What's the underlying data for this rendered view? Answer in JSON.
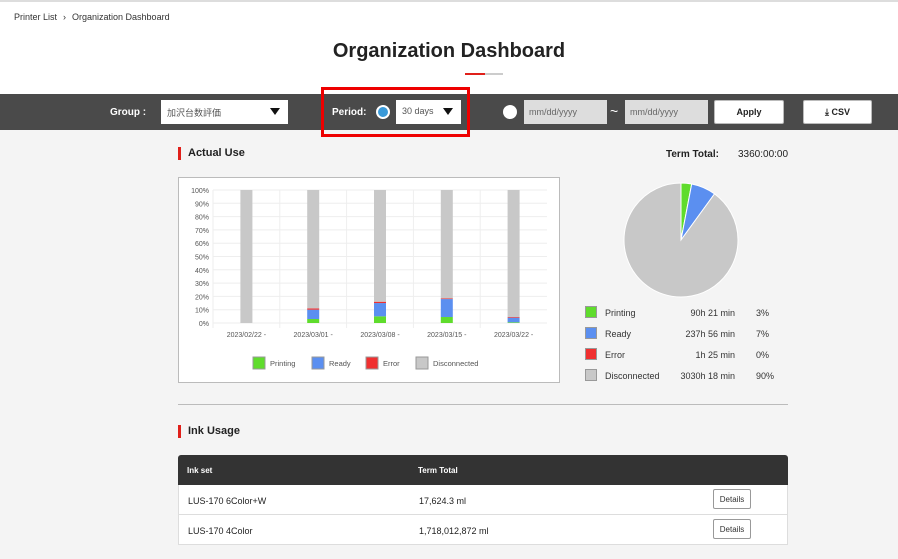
{
  "breadcrumb": [
    "Printer List",
    "Organization Dashboard"
  ],
  "title": "Organization Dashboard",
  "filter": {
    "group_label": "Group :",
    "group_value": "加沢台数評価",
    "period_label": "Period:",
    "period_value": "30 days",
    "date_from_placeholder": "mm/dd/yyyy",
    "date_to_placeholder": "mm/dd/yyyy",
    "tilde": "~",
    "apply": "Apply",
    "csv": "CSV"
  },
  "actual_use": {
    "title": "Actual Use",
    "term_total_label": "Term Total:",
    "term_total": "3360:00:00"
  },
  "colors": {
    "Printing": "#5fdc2c",
    "Ready": "#5b8ff0",
    "Error": "#f03030",
    "Disconnected": "#c8c8c8",
    "accent": "#e0201a"
  },
  "chart_data": [
    {
      "type": "bar",
      "stacked": true,
      "categories": [
        "2023/02/22 -",
        "2023/03/01 -",
        "2023/03/08 -",
        "2023/03/15 -",
        "2023/03/22 -"
      ],
      "ylim": [
        0,
        100
      ],
      "yticks": [
        "0%",
        "10%",
        "20%",
        "30%",
        "40%",
        "50%",
        "60%",
        "70%",
        "80%",
        "90%",
        "100%"
      ],
      "legend": "bottom",
      "grid": true,
      "series": [
        {
          "name": "Printing",
          "values": [
            0,
            3,
            5,
            4.5,
            0.5
          ]
        },
        {
          "name": "Ready",
          "values": [
            0,
            7,
            10,
            13.5,
            3.5
          ]
        },
        {
          "name": "Error",
          "values": [
            0,
            1,
            1,
            0.5,
            0.5
          ]
        },
        {
          "name": "Disconnected",
          "values": [
            100,
            89,
            84,
            81.5,
            95.5
          ]
        }
      ]
    },
    {
      "type": "pie",
      "labels": [
        "Printing",
        "Ready",
        "Error",
        "Disconnected"
      ],
      "values": [
        3,
        7,
        0,
        90
      ],
      "times": [
        "90h 21 min",
        "237h 56 min",
        "1h 25 min",
        "3030h 18 min"
      ],
      "percents": [
        "3%",
        "7%",
        "0%",
        "90%"
      ]
    }
  ],
  "ink": {
    "title": "Ink Usage",
    "headers": [
      "Ink set",
      "Term Total"
    ],
    "rows": [
      {
        "set": "LUS-170 6Color+W",
        "total": "17,624.3 ml",
        "action": "Details"
      },
      {
        "set": "LUS-170 4Color",
        "total": "1,718,012,872 ml",
        "action": "Details"
      }
    ]
  }
}
